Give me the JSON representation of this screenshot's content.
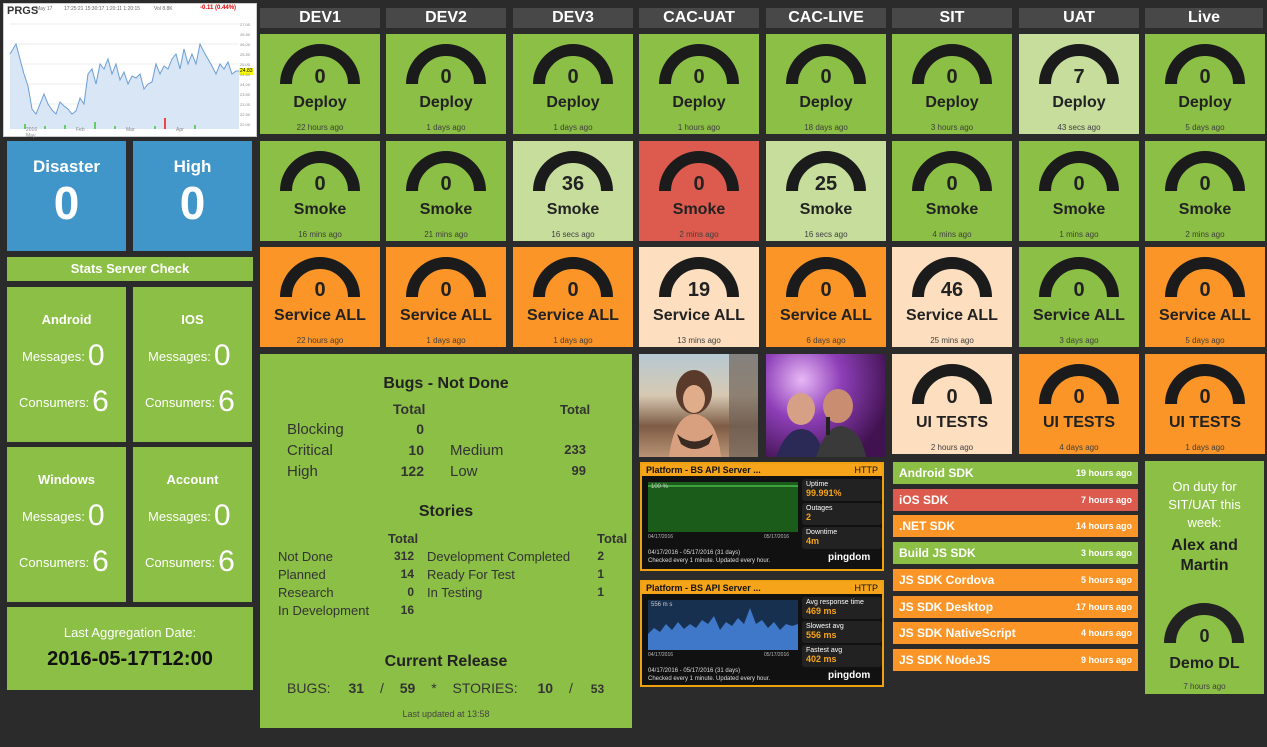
{
  "stock": {
    "ticker": "PRGS",
    "header_date": "May 17",
    "header_info": "17:25:21  15:30:17  1:20:11  1:20:15",
    "header_vol": "Vol 8.8K",
    "header_change": "-0.11 (0.44%)",
    "yaxis": [
      "27.00",
      "26.50",
      "26.00",
      "25.50",
      "25.00",
      "24.50",
      "24.00",
      "23.50",
      "23.00",
      "22.50",
      "22.00"
    ],
    "xaxis": [
      "2016",
      "Feb",
      "Mar",
      "Apr",
      "May"
    ],
    "current": "24.83"
  },
  "envs": [
    "DEV1",
    "DEV2",
    "DEV3",
    "CAC-UAT",
    "CAC-LIVE",
    "SIT",
    "UAT",
    "Live"
  ],
  "rows": [
    {
      "label": "Deploy",
      "cells": [
        {
          "v": "0",
          "ago": "22 hours ago",
          "c": "green"
        },
        {
          "v": "0",
          "ago": "1 days ago",
          "c": "green"
        },
        {
          "v": "0",
          "ago": "1 days ago",
          "c": "green"
        },
        {
          "v": "0",
          "ago": "1 hours ago",
          "c": "green"
        },
        {
          "v": "0",
          "ago": "18 days ago",
          "c": "green"
        },
        {
          "v": "0",
          "ago": "3 hours ago",
          "c": "green"
        },
        {
          "v": "7",
          "ago": "43 secs ago",
          "c": "lgreen"
        },
        {
          "v": "0",
          "ago": "5 days ago",
          "c": "green"
        }
      ]
    },
    {
      "label": "Smoke",
      "cells": [
        {
          "v": "0",
          "ago": "16 mins ago",
          "c": "green"
        },
        {
          "v": "0",
          "ago": "21 mins ago",
          "c": "green"
        },
        {
          "v": "36",
          "ago": "16 secs ago",
          "c": "lgreen"
        },
        {
          "v": "0",
          "ago": "2 mins ago",
          "c": "red"
        },
        {
          "v": "25",
          "ago": "16 secs ago",
          "c": "lgreen"
        },
        {
          "v": "0",
          "ago": "4 mins ago",
          "c": "green"
        },
        {
          "v": "0",
          "ago": "1 mins ago",
          "c": "green"
        },
        {
          "v": "0",
          "ago": "2 mins ago",
          "c": "green"
        }
      ]
    },
    {
      "label": "Service ALL",
      "cells": [
        {
          "v": "0",
          "ago": "22 hours ago",
          "c": "orange"
        },
        {
          "v": "0",
          "ago": "1 days ago",
          "c": "orange"
        },
        {
          "v": "0",
          "ago": "1 days ago",
          "c": "orange"
        },
        {
          "v": "19",
          "ago": "13 mins ago",
          "c": "peach"
        },
        {
          "v": "0",
          "ago": "6 days ago",
          "c": "orange"
        },
        {
          "v": "46",
          "ago": "25 mins ago",
          "c": "peach"
        },
        {
          "v": "0",
          "ago": "3 days ago",
          "c": "green"
        },
        {
          "v": "0",
          "ago": "5 days ago",
          "c": "orange"
        }
      ]
    }
  ],
  "uitests": {
    "label": "UI TESTS",
    "cells": [
      {
        "v": "0",
        "ago": "2 hours ago",
        "c": "peach"
      },
      {
        "v": "0",
        "ago": "4 days ago",
        "c": "orange"
      },
      {
        "v": "0",
        "ago": "1 days ago",
        "c": "orange"
      }
    ]
  },
  "alerts": {
    "disaster_label": "Disaster",
    "disaster": "0",
    "high_label": "High",
    "high": "0"
  },
  "stats_check": "Stats Server Check",
  "queues": [
    {
      "name": "Android",
      "messages": "0",
      "consumers": "6"
    },
    {
      "name": "IOS",
      "messages": "0",
      "consumers": "6"
    },
    {
      "name": "Windows",
      "messages": "0",
      "consumers": "6"
    },
    {
      "name": "Account",
      "messages": "0",
      "consumers": "6"
    }
  ],
  "labels": {
    "messages": "Messages:",
    "consumers": "Consumers:"
  },
  "aggregation": {
    "label": "Last Aggregation Date:",
    "date": "2016-05-17T12:00"
  },
  "bugs": {
    "title": "Bugs - Not Done",
    "total_hd": "Total",
    "rows": [
      {
        "a": "Blocking",
        "av": "0",
        "b": "",
        "bv": ""
      },
      {
        "a": "Critical",
        "av": "10",
        "b": "Medium",
        "bv": "233"
      },
      {
        "a": "High",
        "av": "122",
        "b": "Low",
        "bv": "99"
      }
    ]
  },
  "stories": {
    "title": "Stories",
    "total_hd": "Total",
    "rows": [
      {
        "a": "Not Done",
        "av": "312",
        "b": "Development Completed",
        "bv": "2"
      },
      {
        "a": "Planned",
        "av": "14",
        "b": "Ready For Test",
        "bv": "1"
      },
      {
        "a": "Research",
        "av": "0",
        "b": "In Testing",
        "bv": "1"
      },
      {
        "a": "In Development",
        "av": "16",
        "b": "",
        "bv": ""
      }
    ]
  },
  "release": {
    "title": "Current Release",
    "bugs_label": "BUGS:",
    "bugs_done": "31",
    "bugs_total": "59",
    "star": "*",
    "stories_label": "STORIES:",
    "stories_done": "10",
    "stories_total": "53",
    "sep": "/",
    "updated": "Last updated at 13:58"
  },
  "pingdom": [
    {
      "title": "Platform - BS API Server ...",
      "proto": "HTTP",
      "pct": "100 %",
      "k1": "Uptime",
      "v1": "99.991%",
      "k2": "Outages",
      "v2": "2",
      "k3": "Downtime",
      "v3": "4m",
      "range": "04/17/2016 - 05/17/2016 (31 days)",
      "note": "Checked every 1 minute. Updated every hour.",
      "d1": "04/17/2016",
      "d2": "05/17/2016",
      "brand": "pingdom"
    },
    {
      "title": "Platform - BS API Server ...",
      "proto": "HTTP",
      "pct": "556 m s",
      "k1": "Avg response time",
      "v1": "469 ms",
      "k2": "Slowest avg",
      "v2": "556 ms",
      "k3": "Fastest avg",
      "v3": "402 ms",
      "range": "04/17/2016 - 05/17/2016 (31 days)",
      "note": "Checked every 1 minute. Updated every hour.",
      "d1": "04/17/2016",
      "d2": "05/17/2016",
      "brand": "pingdom"
    }
  ],
  "sdks": [
    {
      "name": "Android SDK",
      "ago": "19 hours ago",
      "c": "green"
    },
    {
      "name": "iOS SDK",
      "ago": "7 hours ago",
      "c": "red"
    },
    {
      "name": ".NET SDK",
      "ago": "14 hours ago",
      "c": "orange"
    },
    {
      "name": "Build JS SDK",
      "ago": "3 hours ago",
      "c": "green"
    },
    {
      "name": "JS SDK Cordova",
      "ago": "5 hours ago",
      "c": "orange"
    },
    {
      "name": "JS SDK Desktop",
      "ago": "17 hours ago",
      "c": "orange"
    },
    {
      "name": "JS SDK NativeScript",
      "ago": "4 hours ago",
      "c": "orange"
    },
    {
      "name": "JS SDK NodeJS",
      "ago": "9 hours ago",
      "c": "orange"
    }
  ],
  "duty": {
    "text": "On duty for SIT/UAT this week:",
    "names": "Alex and Martin",
    "demo_value": "0",
    "demo_label": "Demo DL",
    "demo_ago": "7 hours ago"
  },
  "colors": {
    "green": "#8cbf45",
    "lgreen": "#c6dd9c",
    "red": "#dd5b4e",
    "orange": "#fb9527",
    "peach": "#fddfc0",
    "blue": "#4196c9"
  }
}
